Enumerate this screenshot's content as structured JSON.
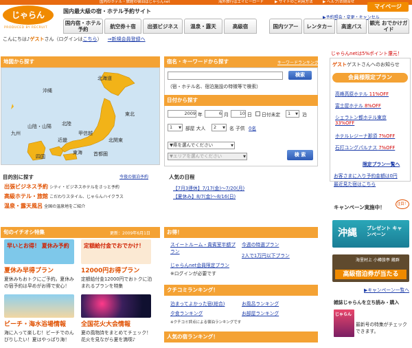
{
  "topbar": {
    "left": "国内のホテル・旅館の宿泊はじゃらんnet",
    "overseas": "海外旅行はエイビーロード",
    "help": "▶ サイトのご利用方法",
    "faq": "▶ ヘルプ/お問合せ"
  },
  "header": {
    "logo": "じゃらん",
    "produced_by": "PRODUCED BY RECRUIT",
    "tagline": "国内最大級の宿・ホテル予約サイト",
    "my_page": "マイページ",
    "reservation": "▶予約照会・変更・キャンセル"
  },
  "nav": {
    "items": [
      "国内宿・ホテル予約",
      "航空券＋宿",
      "出張ビジネス",
      "温泉・露天",
      "高級宿",
      "国内ツアー",
      "レンタカー",
      "高速バス",
      "観光 おでかけガイド"
    ]
  },
  "greeting": {
    "text": "こんにちは♪",
    "guest": "ゲスト",
    "suffix": "さん（ログインは",
    "login": "こちら",
    "close": "）",
    "register": "⇒新規会員登録へ"
  },
  "map": {
    "title": "地図から探す",
    "regions": [
      "北海道",
      "沖縄",
      "東北",
      "北陸",
      "山陰・山陽",
      "甲信越",
      "九州",
      "近畿",
      "北関東",
      "四国",
      "東海",
      "首都圏"
    ]
  },
  "search": {
    "title": "宿名・キーワードから探す",
    "keyword_ranking": "キーワードランキング",
    "keyword_value": "",
    "search_btn": "検索",
    "hint": "（宿・ホテル名、宿泊施設の特徴等で検索）",
    "date_title": "日付から探す",
    "year": "2009",
    "year_label": "年",
    "month": "6",
    "month_label": "月",
    "day": "10",
    "day_label": "日",
    "undecided": "日付未定",
    "nights": "1",
    "nights_label": "泊",
    "rooms": "1",
    "rooms_label": "部屋 大人",
    "adults": "2",
    "adults_label": "名 子供",
    "children": "0名",
    "prefecture": "▼県を選んでください",
    "area": "▼エリアを選んでください",
    "search_btn2": "検 索"
  },
  "purpose": {
    "title": "目的別に探す",
    "today": "今夜の宿泊予約",
    "items": [
      {
        "label": "出張ビジネス予約",
        "desc": "シティ・ビジネスホテルをさっと予約"
      },
      {
        "label": "高級ホテル・旅館",
        "desc": "こだわりスタイル、じゃらんハイクラス"
      },
      {
        "label": "温泉・露天風呂",
        "desc": "全国の温泉地をご紹介"
      }
    ]
  },
  "schedule": {
    "title": "人気の日程",
    "items": [
      "【7月3連休】7/17(金)〜7/20(月)",
      "【夏休み】8/7(金)〜8/16(日)"
    ]
  },
  "feature": {
    "title": "旬のイチオシ特集",
    "updated": "更新：2009年6月1日",
    "cards": [
      {
        "banner": "早いとお得！ 夏休み予約",
        "label": "夏休み早得プラン",
        "desc": "夏休みもおトクにご予約。夏休みの宿予約は早めがお得で安心！"
      },
      {
        "banner": "定額給付金でおでかけ！",
        "label": "12000円お得プラン",
        "desc": "定額給付金12000円でおトクに泊まれるプランを特集"
      },
      {
        "banner": "",
        "label": "ビーチ・海水浴場情報",
        "desc": "海に入って楽しむ！ビーチでのんびりしたい！夏はやっぱり海！"
      },
      {
        "banner": "",
        "label": "全国花火大会情報",
        "desc": "夏の風物詩をまとめてチェック！花火を見ながら夏を満喫♪"
      }
    ]
  },
  "otoku": {
    "title": "お得！",
    "links": [
      "スイートルーム・貴賓室半額プラン",
      "今週の特選プラン",
      "じゃらんnet会員限定プラン",
      "2人で1万円以下プラン"
    ],
    "note": "※ログインが必要です"
  },
  "kuchikomi": {
    "title": "クチコミランキング！",
    "links": [
      "泊まってよかった宿(総合)",
      "お風呂ランキング",
      "夕食ランキング",
      "お部屋ランキング"
    ],
    "note": "※クチコミ評点による宿泊ランキングです"
  },
  "popular": {
    "title": "人気の宿ランキング！"
  },
  "side": {
    "points": "じゃらんnetは5%ポイント還元！",
    "guest_line": "ゲストさんへのお知らせ",
    "member_plan": "会員様限定プラン",
    "plans": [
      {
        "name": "高峰高原ホテル",
        "off": "11%OFF"
      },
      {
        "name": "富士屋ホテル",
        "off": "8%OFF"
      },
      {
        "name": "シェラトン都ホテル東京",
        "off": "33%OFF"
      },
      {
        "name": "ホテルレジーナ那須",
        "off": "7%OFF"
      },
      {
        "name": "石打ユングパルナス",
        "off": "7%OFF"
      }
    ],
    "plan_list": "限定プラン一覧へ",
    "notice1": "お客さまに入り予約金額は0円",
    "notice2": "最近見た宿はこちら",
    "campaign": "キャンペーン実施中！",
    "attention": "注目！",
    "okinawa_title": "沖縄",
    "okinawa_sub": "プレゼント キャンペーン",
    "banner2_top": "海里村上 小樽旅亭 蔵群",
    "banner2_main": "高級宿泊券が当たる",
    "campaign_list": "▶キャンペーン一覧へ",
    "magazine": "雑誌じゃらんを立ち読み・購入",
    "magazine_cover": "じゃらん",
    "magazine_desc": "最新号の特集がチェックできます。"
  },
  "colors": {
    "orange": "#f4a234",
    "brand": "#f08a00",
    "link": "#1a3aa8",
    "map_land": "#f2b318",
    "map_sea": "#cfe4f3"
  }
}
